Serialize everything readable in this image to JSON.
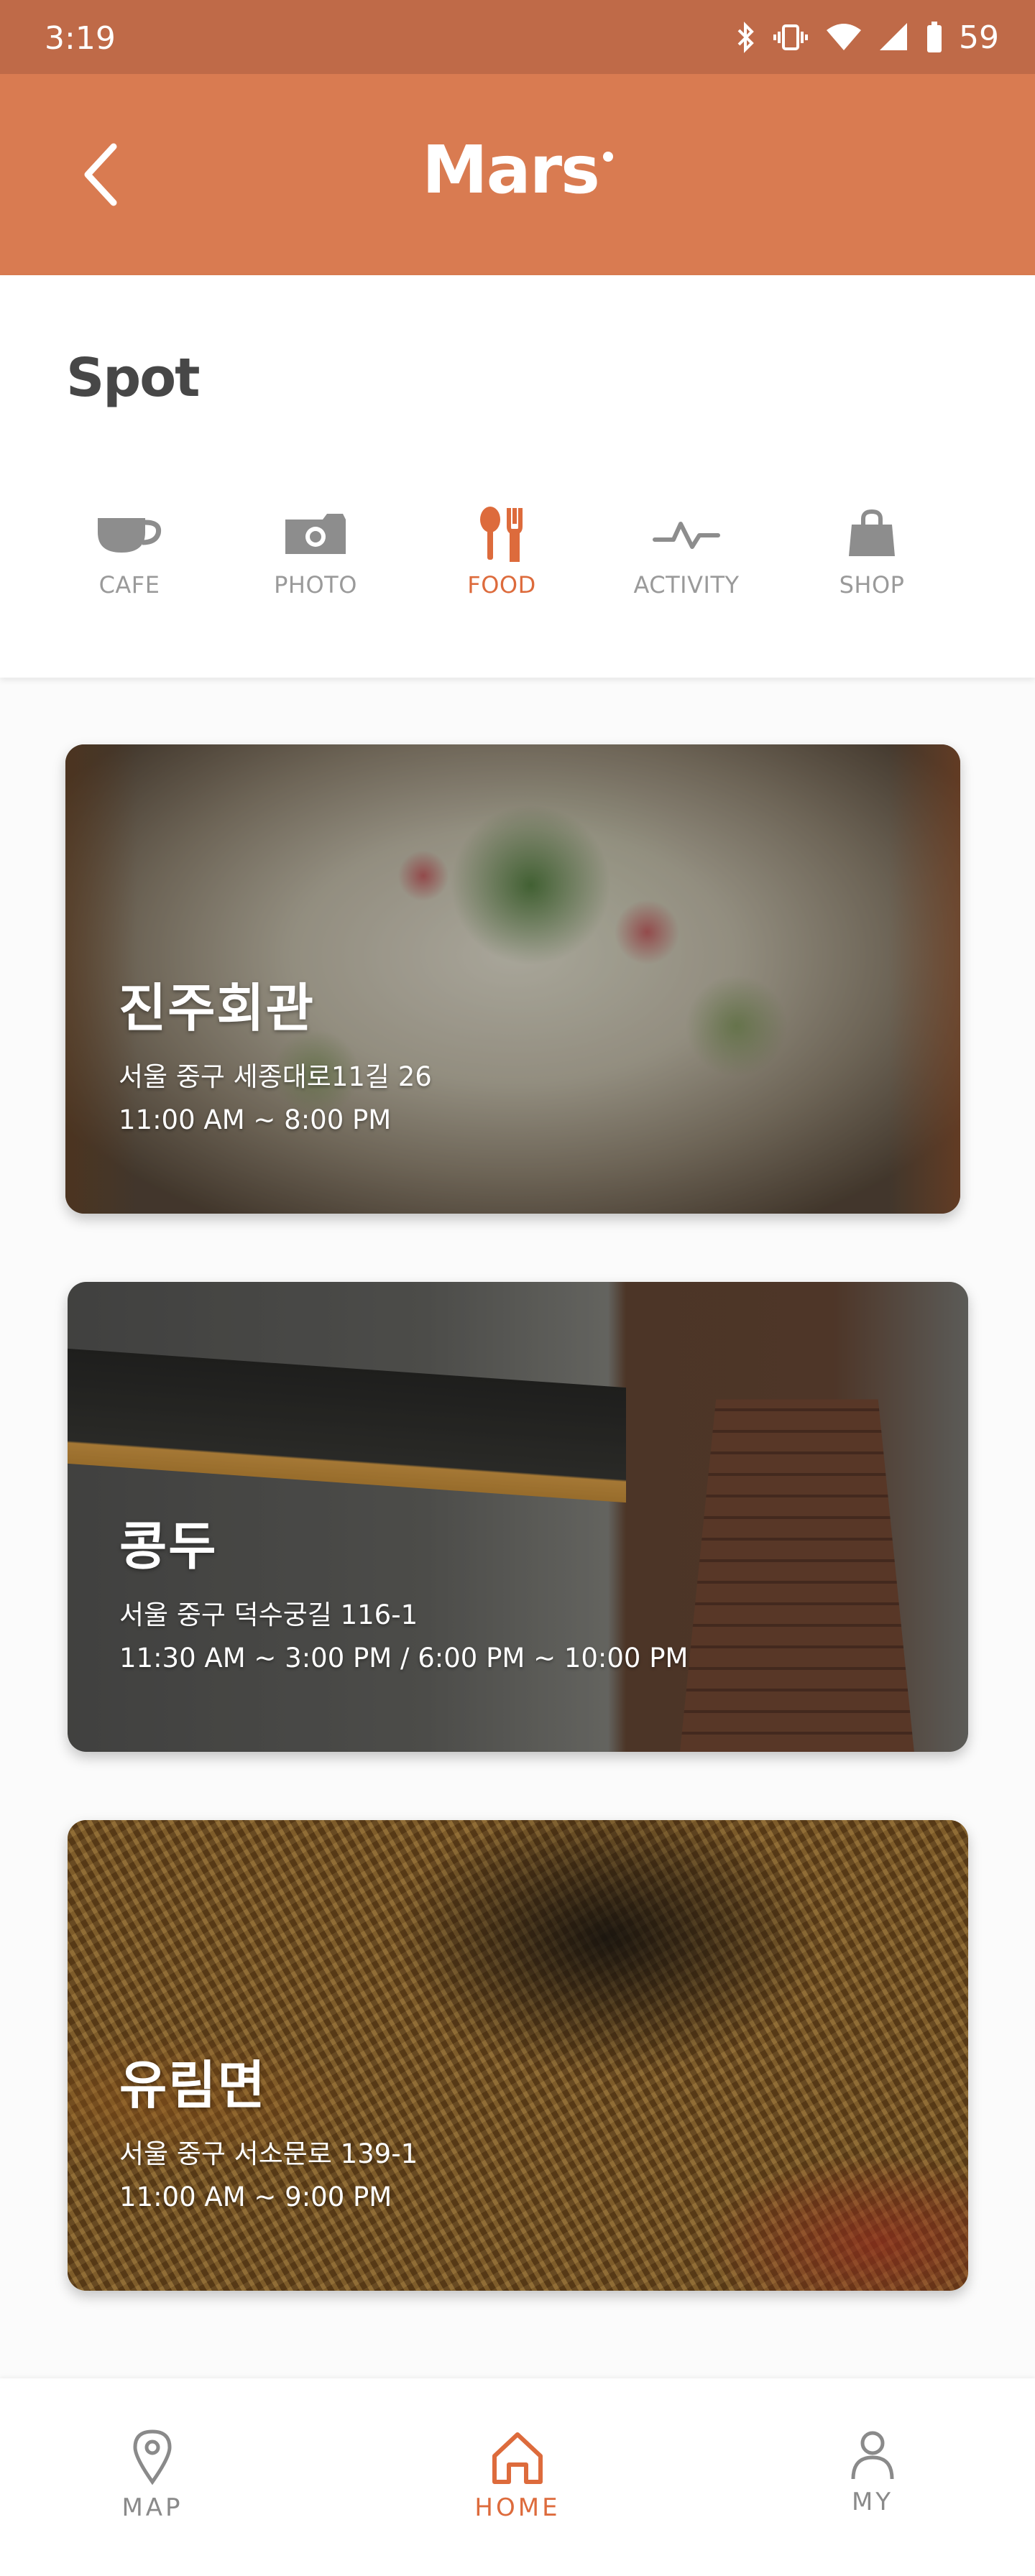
{
  "status_bar": {
    "time": "3:19",
    "battery": "59"
  },
  "header": {
    "title": "Mars"
  },
  "spot": {
    "title": "Spot",
    "categories": [
      {
        "label": "CAFE",
        "icon": "cafe-icon"
      },
      {
        "label": "PHOTO",
        "icon": "camera-icon"
      },
      {
        "label": "FOOD",
        "icon": "food-icon",
        "active": true
      },
      {
        "label": "ACTIVITY",
        "icon": "activity-icon"
      },
      {
        "label": "SHOP",
        "icon": "shopping-bag-icon"
      }
    ]
  },
  "places": [
    {
      "name": "진주회관",
      "address": "서울 중구 세종대로11길 26",
      "hours": "11:00 AM ~ 8:00 PM"
    },
    {
      "name": "콩두",
      "address": "서울 중구 덕수궁길 116-1",
      "hours": "11:30 AM ~ 3:00 PM / 6:00 PM ~ 10:00 PM"
    },
    {
      "name": "유림면",
      "address": "서울 중구 서소문로 139-1",
      "hours": "11:00 AM ~ 9:00 PM"
    }
  ],
  "bottom_nav": {
    "items": [
      {
        "label": "MAP",
        "icon": "map-pin-icon"
      },
      {
        "label": "HOME",
        "icon": "home-icon",
        "active": true
      },
      {
        "label": "MY",
        "icon": "user-icon"
      }
    ]
  },
  "colors": {
    "accent": "#dd6b3c",
    "header": "#d97b51",
    "status_bar": "#bf6a48"
  }
}
